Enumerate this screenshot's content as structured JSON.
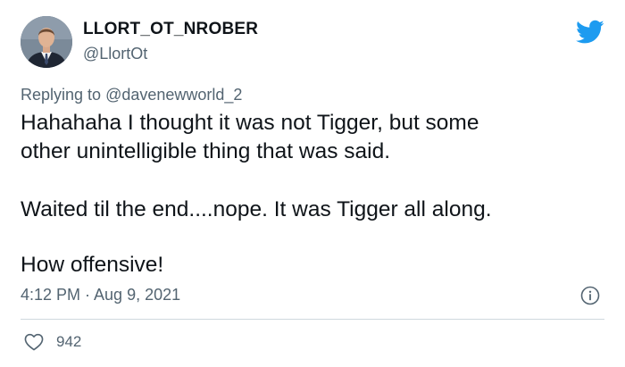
{
  "author": {
    "display_name": "LLORT_OT_NROBER",
    "handle": "@LlortOt"
  },
  "reply": {
    "prefix": "Replying to",
    "mention": "@davenewworld_2"
  },
  "tweet": {
    "lines_p1": [
      "Hahahaha I thought it was not Tigger, but some",
      "other unintelligible thing that was said."
    ],
    "p2": "Waited til the end....nope. It was Tigger all along.",
    "p3": "How offensive!"
  },
  "meta": {
    "timestamp": "4:12 PM · Aug 9, 2021",
    "likes": "942"
  },
  "icons": {
    "brand": "twitter-bird-icon",
    "info": "info-icon",
    "like": "heart-icon"
  },
  "colors": {
    "brand_blue": "#1d9bf0",
    "secondary_text": "#536471",
    "primary_text": "#0f1419",
    "divider": "#cfd9de"
  }
}
